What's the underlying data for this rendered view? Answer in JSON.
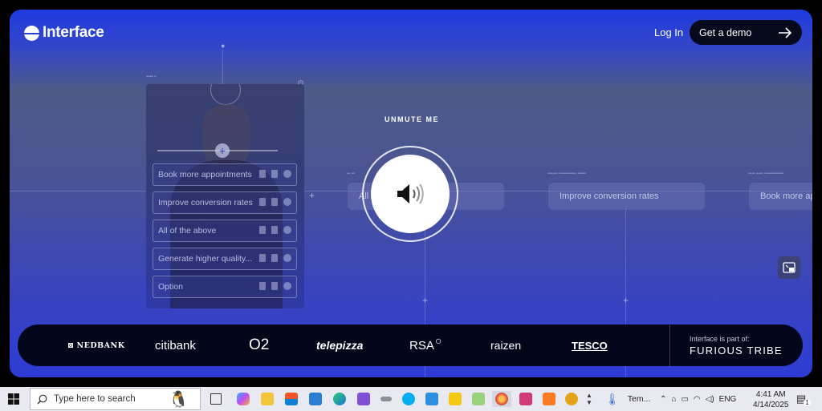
{
  "header": {
    "brand_name": "Interface",
    "login_label": "Log In",
    "demo_label": "Get a demo"
  },
  "flow_canvas": {
    "options": [
      {
        "label": "Book more appointments"
      },
      {
        "label": "Improve conversion rates"
      },
      {
        "label": "All of the above"
      },
      {
        "label": "Generate higher quality..."
      },
      {
        "label": "Option"
      }
    ],
    "nodes": [
      {
        "label": "All"
      },
      {
        "label": "Improve conversion rates"
      },
      {
        "label": "Book more ap"
      }
    ]
  },
  "video_overlay": {
    "unmute_label": "UNMUTE ME",
    "sound_icon": "speaker-volume-icon",
    "pip_icon": "picture-in-picture-icon"
  },
  "logo_strip": {
    "brands": [
      "NEDBANK",
      "citibank",
      "O2",
      "telepizza",
      "RSA",
      "raizen",
      "TESCO"
    ],
    "part_of_label": "Interface is part of:",
    "parent_brand": "FURIOUS TRIBE"
  },
  "taskbar": {
    "search_placeholder": "Type here to search",
    "weather_label": "Tem...",
    "language": "ENG",
    "time": "4:41 AM",
    "date": "4/14/2025",
    "notification_count": "1",
    "accent_color": "#2a40d8"
  }
}
